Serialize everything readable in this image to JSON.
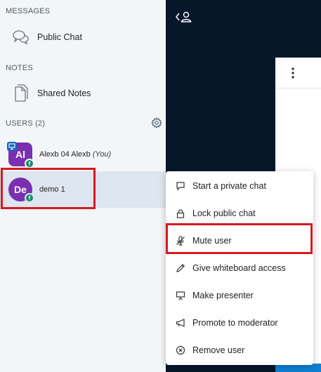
{
  "sidebar": {
    "messages": {
      "title": "MESSAGES",
      "items": [
        {
          "label": "Public Chat",
          "icon": "chat-bubbles-icon"
        }
      ]
    },
    "notes": {
      "title": "NOTES",
      "items": [
        {
          "label": "Shared Notes",
          "icon": "document-icon"
        }
      ]
    },
    "users": {
      "title": "USERS (2)",
      "list": [
        {
          "initials": "Al",
          "name": "Alexb 04 Alexb",
          "suffix": "(You)",
          "color": "#7b2fb1",
          "shape": "rounded-square",
          "presenter": true
        },
        {
          "initials": "De",
          "name": "demo 1",
          "suffix": "",
          "color": "#7b2fb1",
          "shape": "circle",
          "presenter": false
        }
      ]
    }
  },
  "context_menu": {
    "items": [
      {
        "label": "Start a private chat",
        "icon": "chat-icon"
      },
      {
        "label": "Lock public chat",
        "icon": "lock-icon"
      },
      {
        "label": "Mute user",
        "icon": "microphone-muted-icon"
      },
      {
        "label": "Give whiteboard access",
        "icon": "pencil-icon"
      },
      {
        "label": "Make presenter",
        "icon": "presentation-icon"
      },
      {
        "label": "Promote to moderator",
        "icon": "megaphone-icon"
      },
      {
        "label": "Remove user",
        "icon": "remove-circle-icon"
      }
    ]
  },
  "top_bar": {
    "icon": "user-list-toggle-icon"
  },
  "colors": {
    "dark_panel": "#06172a",
    "highlight": "#d7191f",
    "accent_blue": "#0f7fd4",
    "avatar_purple": "#7b2fb1",
    "voice_badge": "#1b8a6e"
  }
}
